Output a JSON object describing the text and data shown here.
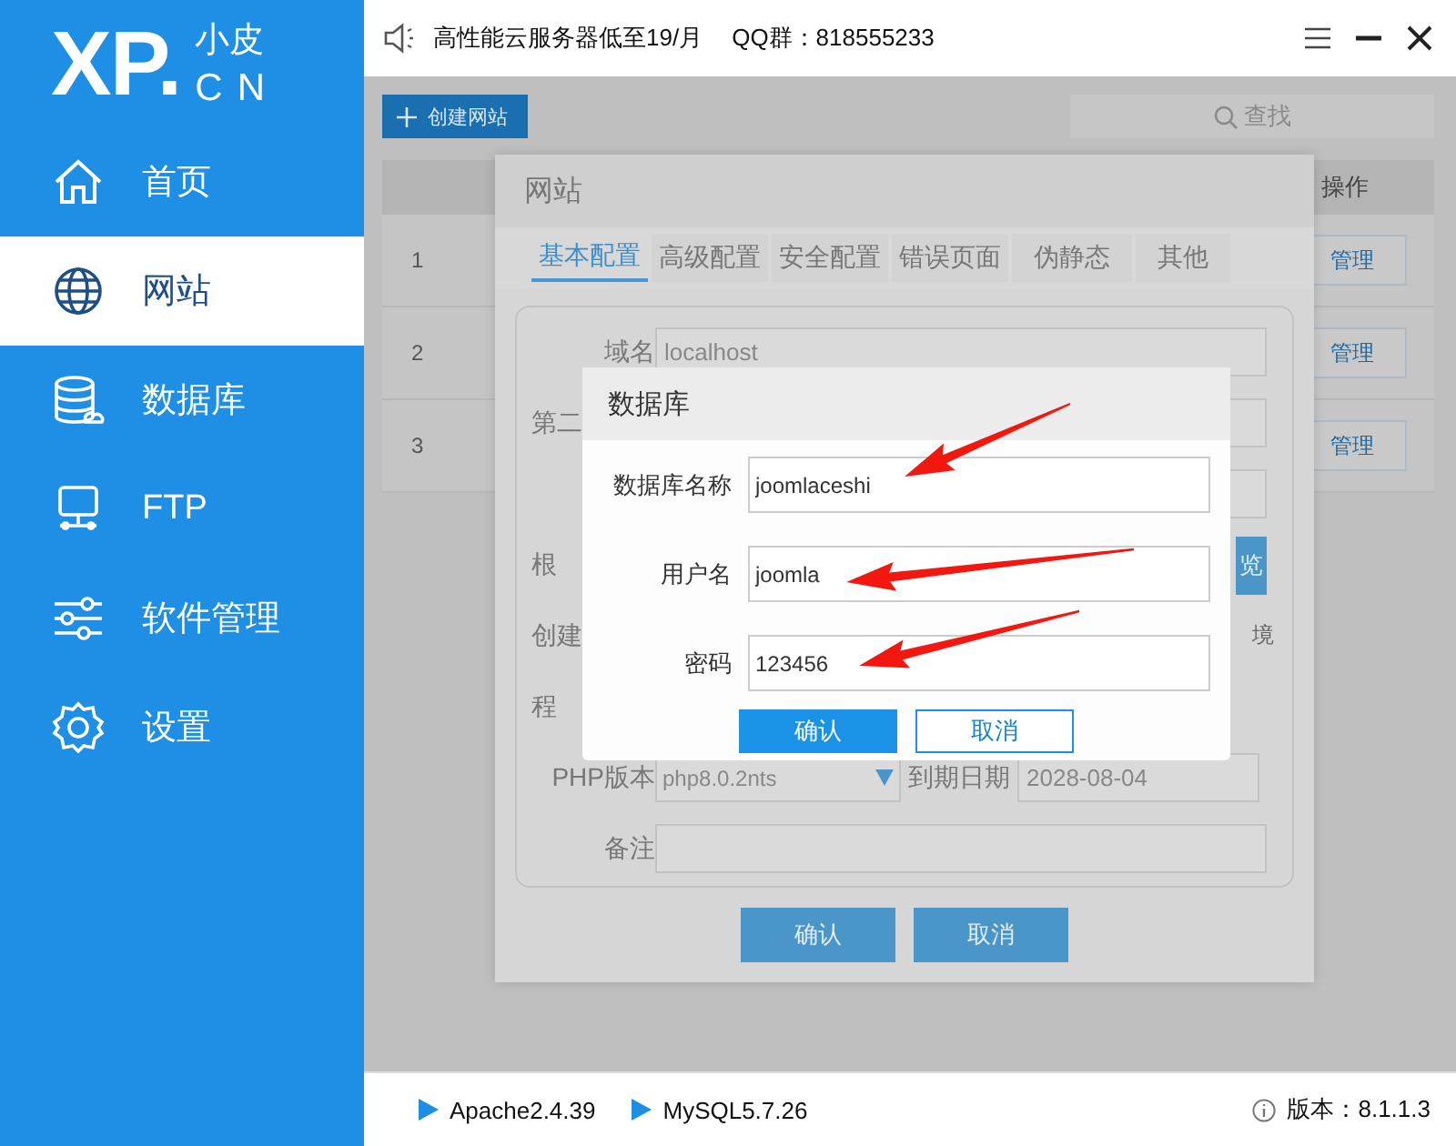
{
  "sidebar": {
    "logo": {
      "mark": "XP.",
      "name": "小皮",
      "suffix": "CN"
    },
    "items": [
      {
        "label": "首页",
        "selected": false
      },
      {
        "label": "网站",
        "selected": true
      },
      {
        "label": "数据库",
        "selected": false
      },
      {
        "label": "FTP",
        "selected": false
      },
      {
        "label": "软件管理",
        "selected": false
      },
      {
        "label": "设置",
        "selected": false
      }
    ]
  },
  "header": {
    "notice": "高性能云服务器低至19/月",
    "qq": "QQ群：818555233"
  },
  "toolbar": {
    "create_button": "创建网站",
    "search": {
      "placeholder": "查找"
    }
  },
  "table": {
    "action_column": "操作",
    "rows": [
      {
        "index": "1",
        "action": "管理"
      },
      {
        "index": "2",
        "action": "管理"
      },
      {
        "index": "3",
        "action": "管理"
      }
    ]
  },
  "site_dialog": {
    "title": "网站",
    "tabs": [
      {
        "label": "基本配置",
        "selected": true
      },
      {
        "label": "高级配置",
        "selected": false
      },
      {
        "label": "安全配置",
        "selected": false
      },
      {
        "label": "错误页面",
        "selected": false
      },
      {
        "label": "伪静态",
        "selected": false
      },
      {
        "label": "其他",
        "selected": false
      }
    ],
    "fields": [
      {
        "kind": "text",
        "label": "域名",
        "value": "localhost"
      },
      {
        "kind": "covered",
        "label": "第二"
      },
      {
        "kind": "text"
      },
      {
        "kind": "browse",
        "label": "根",
        "button": "览"
      },
      {
        "kind": "note",
        "label": "创建",
        "note": "境"
      },
      {
        "kind": "plain",
        "label": "程"
      },
      {
        "kind": "php",
        "label": "PHP版本",
        "select": "php8.0.2nts",
        "date_label": "到期日期",
        "date": "2028-08-04"
      },
      {
        "kind": "text",
        "label": "备注"
      }
    ],
    "buttons": [
      "确认",
      "取消"
    ]
  },
  "database_dialog": {
    "title": "数据库",
    "fields": [
      {
        "label": "数据库名称",
        "value": "joomlaceshi"
      },
      {
        "label": "用户名",
        "value": "joomla"
      },
      {
        "label": "密码",
        "value": "123456"
      }
    ],
    "confirm": "确认",
    "cancel": "取消"
  },
  "status_bar": {
    "services": [
      "Apache2.4.39",
      "MySQL5.7.26"
    ],
    "version": "版本：8.1.1.3"
  }
}
